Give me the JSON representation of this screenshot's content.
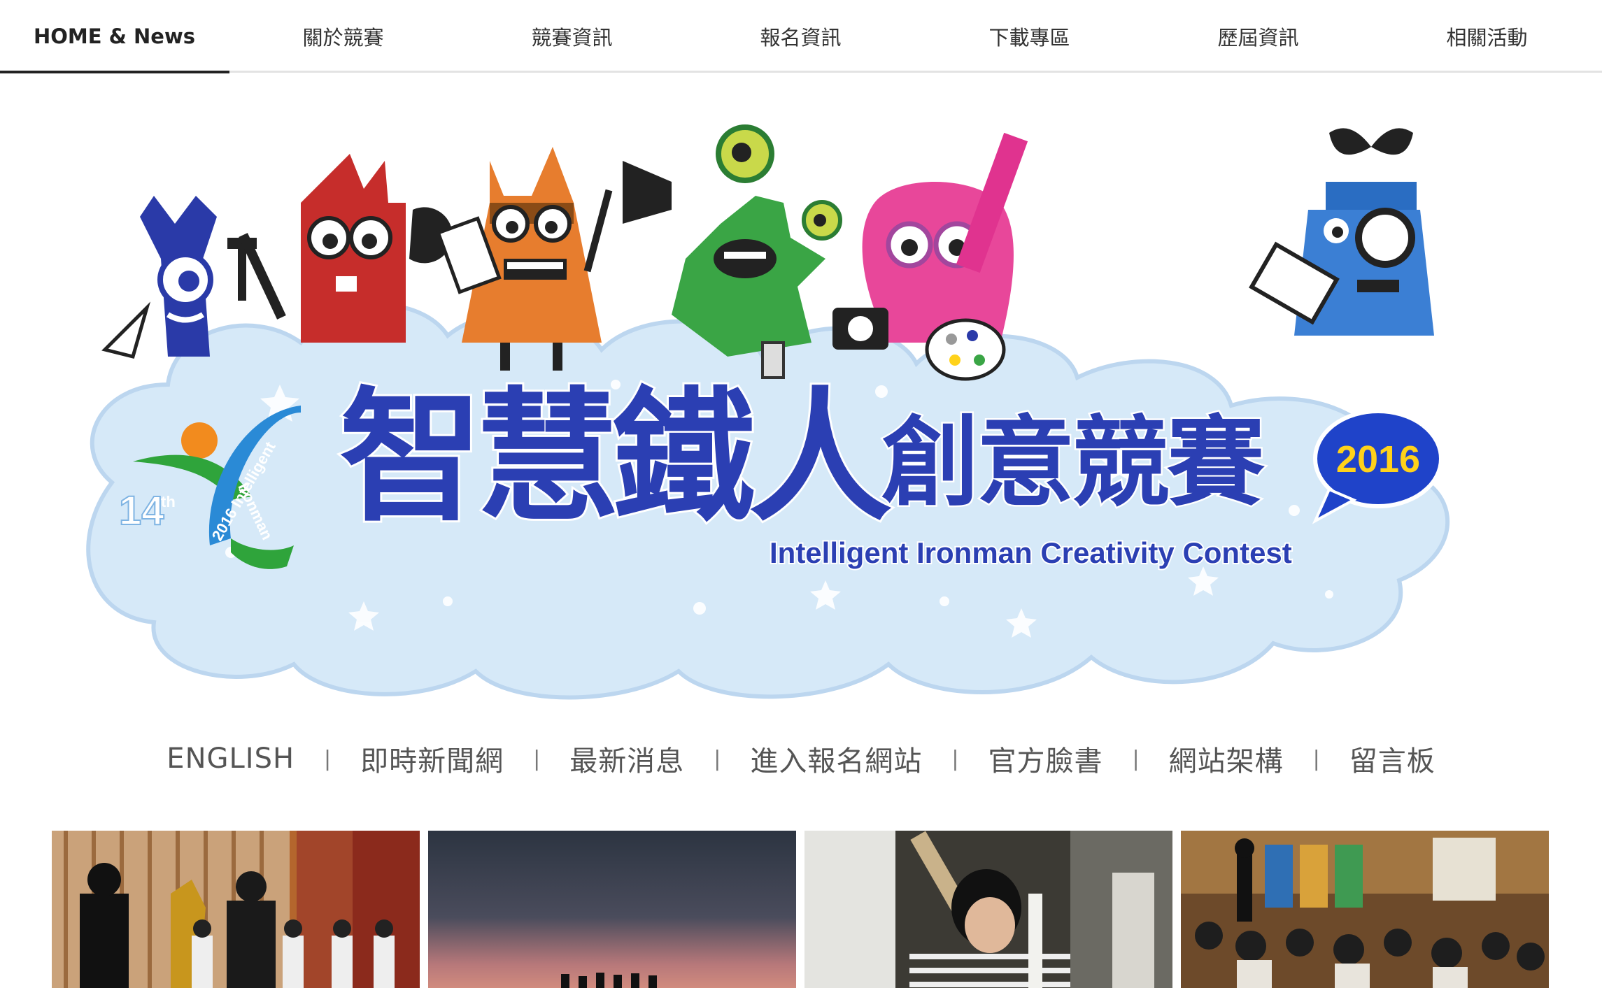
{
  "topnav": {
    "items": [
      "HOME & News",
      "關於競賽",
      "競賽資訊",
      "報名資訊",
      "下載專區",
      "歷屆資訊",
      "相關活動"
    ],
    "active_index": 0
  },
  "banner": {
    "title_zh_1": "智慧鐵人",
    "title_zh_2": "創意競賽",
    "title_en": "Intelligent Ironman Creativity Contest",
    "year_badge": "2016",
    "logo_edition": "14",
    "logo_edition_sup": "th",
    "logo_text_1": "2016 Intelligent",
    "logo_text_2": "Ironman"
  },
  "subnav": {
    "links": [
      "ENGLISH",
      "即時新聞網",
      "最新消息",
      "進入報名網站",
      "官方臉書",
      "網站架構",
      "留言板"
    ]
  },
  "colors": {
    "cloud": "#d6e9f8",
    "title_blue": "#2b3fb3",
    "badge_blue": "#1f43c9",
    "badge_yellow": "#ffd21a"
  }
}
